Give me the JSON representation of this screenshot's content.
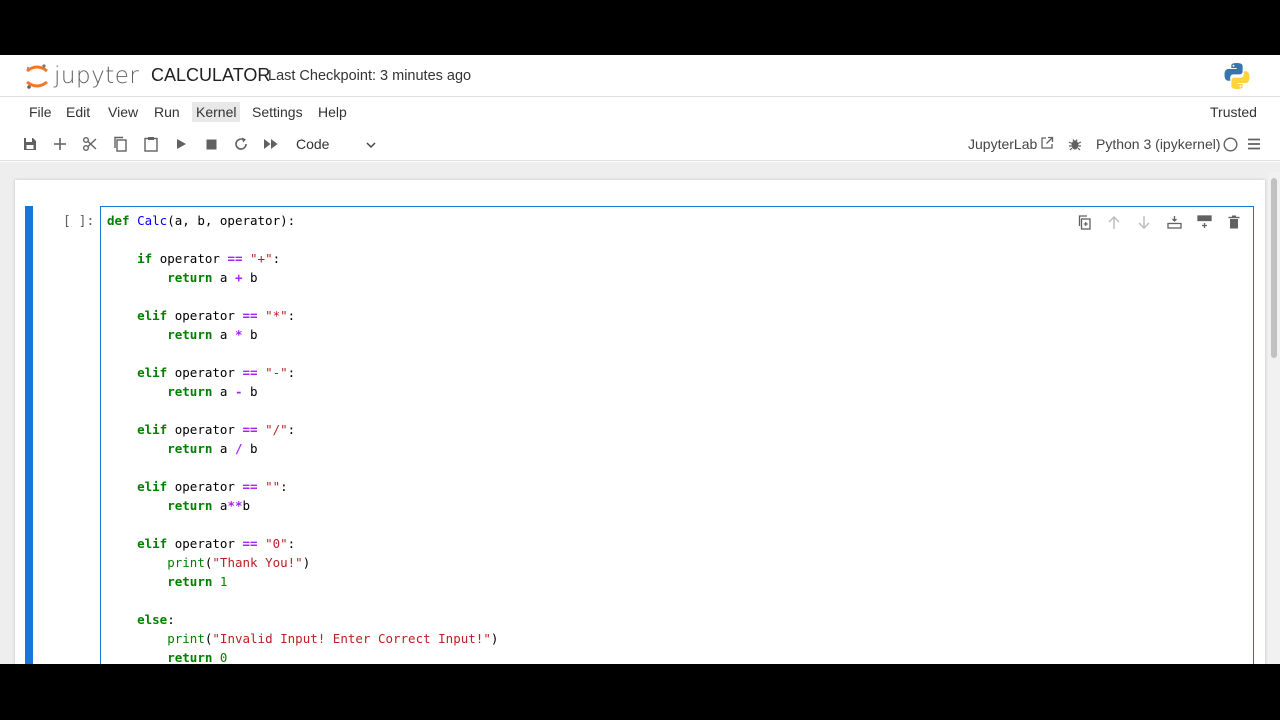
{
  "header": {
    "logo_text": "jupyter",
    "notebook_title": "CALCULATOR",
    "checkpoint": "Last Checkpoint: 3 minutes ago"
  },
  "menu": {
    "items": [
      "File",
      "Edit",
      "View",
      "Run",
      "Kernel",
      "Settings",
      "Help"
    ],
    "active": "Kernel",
    "trusted": "Trusted"
  },
  "toolbar": {
    "cell_type": "Code",
    "jupyterlab_label": "JupyterLab",
    "kernel_name": "Python 3 (ipykernel)"
  },
  "cell": {
    "prompt": "[ ]:"
  },
  "code_lines": [
    "def Calc(a, b, operator):",
    "",
    "    if operator == \"+\":",
    "        return a + b",
    "",
    "    elif operator == \"*\":",
    "        return a * b",
    "",
    "    elif operator == \"-\":",
    "        return a - b",
    "",
    "    elif operator == \"/\":",
    "        return a / b",
    "",
    "    elif operator == \"\":",
    "        return a**b",
    "",
    "    elif operator == \"0\":",
    "        print(\"Thank You!\")",
    "        return 1",
    "",
    "    else:",
    "        print(\"Invalid Input! Enter Correct Input!\")",
    "        return 0"
  ],
  "colors": {
    "accent": "#1976d2",
    "keyword": "#008000",
    "string": "#ba2121",
    "operator": "#aa22ff"
  }
}
